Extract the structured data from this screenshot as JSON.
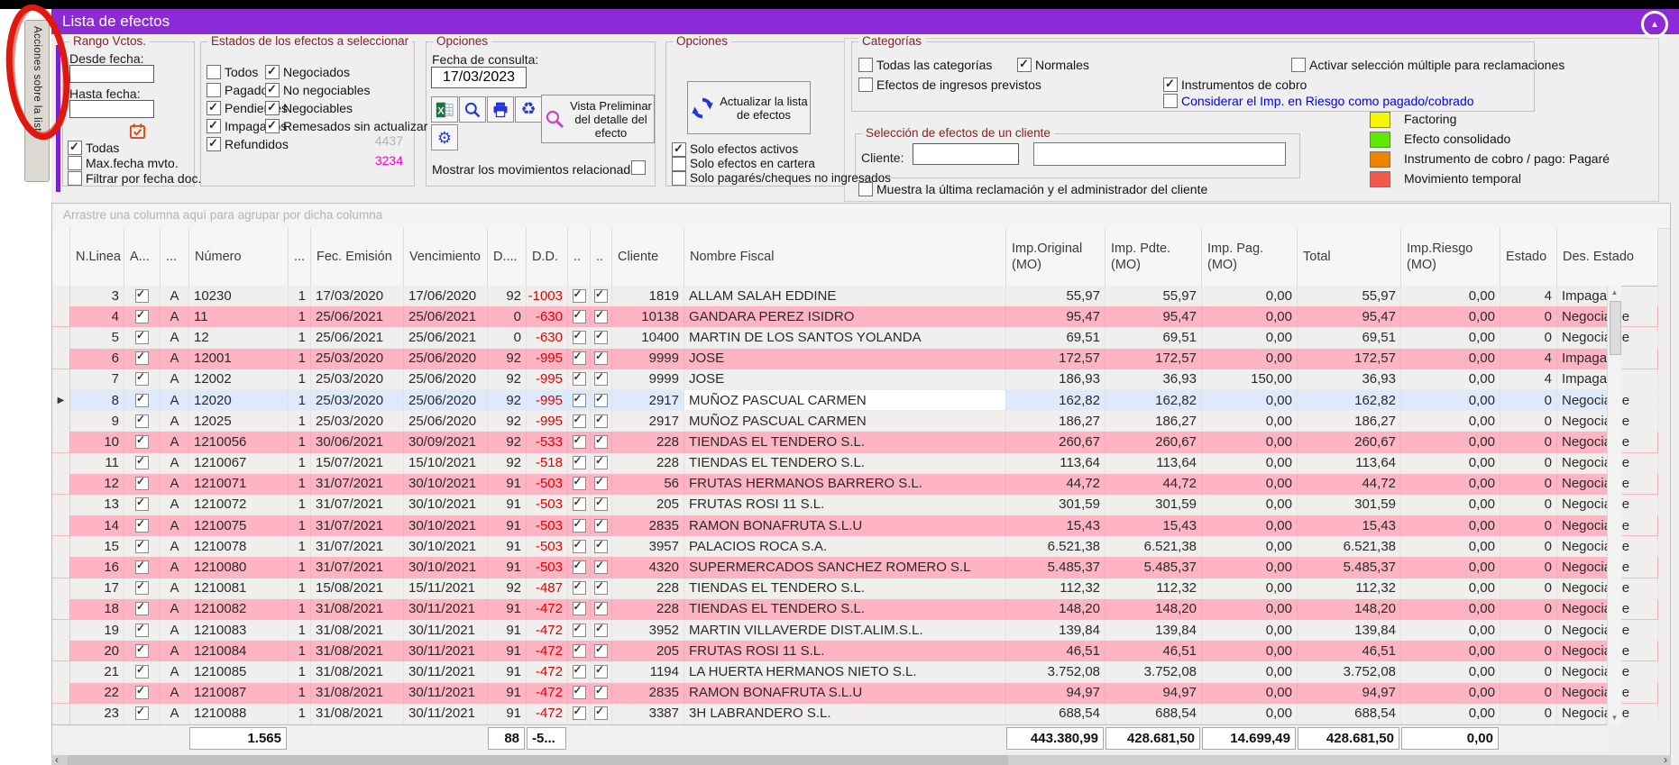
{
  "window": {
    "title": "Lista de efectos"
  },
  "side_tab": {
    "label": "Acciones sobre la lista"
  },
  "icons": {
    "collapse": "▲",
    "scroll_up": "▲",
    "scroll_down": "▼",
    "scroll_left": "‹",
    "scroll_right": "›",
    "row_indicator": "▶"
  },
  "panels": {
    "rango": {
      "title": "Rango Vctos.",
      "desde_label": "Desde fecha:",
      "desde_value": "",
      "hasta_label": "Hasta fecha:",
      "hasta_value": "",
      "todas": {
        "label": "Todas",
        "checked": true
      },
      "max_fecha": {
        "label": "Max.fecha mvto.",
        "checked": false
      },
      "filtrar": {
        "label": "Filtrar por fecha doc.",
        "checked": false
      }
    },
    "estados": {
      "title": "Estados de los efectos a seleccionar",
      "col1": [
        {
          "label": "Todos",
          "checked": false
        },
        {
          "label": "Pagados",
          "checked": false
        },
        {
          "label": "Pendientes",
          "checked": true
        },
        {
          "label": "Impagados",
          "checked": true
        },
        {
          "label": "Refundidos",
          "checked": true
        }
      ],
      "col2": [
        {
          "label": "Negociados",
          "checked": true
        },
        {
          "label": "No negociables",
          "checked": true
        },
        {
          "label": "Negociables",
          "checked": true
        },
        {
          "label": "Remesados sin actualizar",
          "checked": true
        }
      ],
      "count_gray": "4437",
      "count_magenta": "3234"
    },
    "opciones1": {
      "title": "Opciones",
      "fecha_label": "Fecha de consulta:",
      "fecha_value": "17/03/2023",
      "preview_button": "Vista Preliminar del detalle del efecto",
      "mostrar": {
        "label": "Mostrar los movimientos relacionados",
        "checked": false
      }
    },
    "opciones2": {
      "title": "Opciones",
      "actualizar_button": "Actualizar la lista de efectos",
      "checks": [
        {
          "label": "Solo efectos activos",
          "checked": true
        },
        {
          "label": "Solo efectos en cartera",
          "checked": false
        },
        {
          "label": "Solo pagarés/cheques no ingresados",
          "checked": false
        }
      ]
    },
    "categorias": {
      "title": "Categorías",
      "todas_categorias": {
        "label": "Todas las categorías",
        "checked": false
      },
      "normales": {
        "label": "Normales",
        "checked": true
      },
      "efectos_ingresos": {
        "label": "Efectos de ingresos previstos",
        "checked": false
      },
      "instrumentos_cobro": {
        "label": "Instrumentos de cobro",
        "checked": true
      },
      "activar_seleccion": {
        "label": "Activar selección múltiple para reclamaciones",
        "checked": false
      },
      "considerar_riesgo": {
        "label": "Considerar el Imp. en Riesgo como pagado/cobrado",
        "checked": false
      }
    },
    "seleccion": {
      "title": "Selección de efectos de un cliente",
      "cliente_label": "Cliente:",
      "cliente_code": "",
      "cliente_name": ""
    },
    "muestra": {
      "label": "Muestra la última reclamación y el administrador del cliente",
      "checked": false
    }
  },
  "legend": [
    {
      "label": "Factoring",
      "color": "#f6f600"
    },
    {
      "label": "Efecto consolidado",
      "color": "#5fe800"
    },
    {
      "label": "Instrumento de cobro / pago: Pagaré",
      "color": "#ef8200"
    },
    {
      "label": "Movimiento temporal",
      "color": "#f2594a"
    }
  ],
  "grid": {
    "group_hint": "Arrastre una columna aquí para agrupar por dicha columna",
    "columns": [
      "N.Linea",
      "A...",
      "...",
      "Número",
      "...",
      "Fec. Emisión",
      "Vencimiento",
      "D....",
      "D.D.",
      "..",
      "..",
      "Cliente",
      "Nombre Fiscal",
      "Imp.Original (MO)",
      "Imp. Pdte. (MO)",
      "Imp. Pag. (MO)",
      "Total",
      "Imp.Riesgo (MO)",
      "Estado",
      "Des. Estado"
    ],
    "rows": [
      {
        "n": "3",
        "check": true,
        "letter": "A",
        "numero": "10230",
        "uno": "1",
        "emi": "17/03/2020",
        "ven": "17/06/2020",
        "d": "92",
        "dd": "-1003",
        "c1": true,
        "c2": true,
        "cliente": "1819",
        "nombre": "ALLAM SALAH EDDINE",
        "orig": "55,97",
        "pdte": "55,97",
        "pag": "0,00",
        "total": "55,97",
        "riesgo": "0,00",
        "estado": "4",
        "des": "Impagado",
        "bg": "white"
      },
      {
        "n": "4",
        "check": true,
        "letter": "A",
        "numero": "11",
        "uno": "1",
        "emi": "25/06/2021",
        "ven": "25/06/2021",
        "d": "0",
        "dd": "-630",
        "c1": true,
        "c2": true,
        "cliente": "10138",
        "nombre": "GANDARA PEREZ ISIDRO",
        "orig": "95,47",
        "pdte": "95,47",
        "pag": "0,00",
        "total": "95,47",
        "riesgo": "0,00",
        "estado": "0",
        "des": "Negociable",
        "bg": "pink"
      },
      {
        "n": "5",
        "check": true,
        "letter": "A",
        "numero": "12",
        "uno": "1",
        "emi": "25/06/2021",
        "ven": "25/06/2021",
        "d": "0",
        "dd": "-630",
        "c1": true,
        "c2": true,
        "cliente": "10400",
        "nombre": "MARTIN DE LOS SANTOS YOLANDA",
        "orig": "69,51",
        "pdte": "69,51",
        "pag": "0,00",
        "total": "69,51",
        "riesgo": "0,00",
        "estado": "0",
        "des": "Negociable",
        "bg": "white"
      },
      {
        "n": "6",
        "check": true,
        "letter": "A",
        "numero": "12001",
        "uno": "1",
        "emi": "25/03/2020",
        "ven": "25/06/2020",
        "d": "92",
        "dd": "-995",
        "c1": true,
        "c2": true,
        "cliente": "9999",
        "nombre": "JOSE",
        "orig": "172,57",
        "pdte": "172,57",
        "pag": "0,00",
        "total": "172,57",
        "riesgo": "0,00",
        "estado": "4",
        "des": "Impagado",
        "bg": "pink"
      },
      {
        "n": "7",
        "check": true,
        "letter": "A",
        "numero": "12002",
        "uno": "1",
        "emi": "25/03/2020",
        "ven": "25/06/2020",
        "d": "92",
        "dd": "-995",
        "c1": true,
        "c2": true,
        "cliente": "9999",
        "nombre": "JOSE",
        "orig": "186,93",
        "pdte": "36,93",
        "pag": "150,00",
        "total": "36,93",
        "riesgo": "0,00",
        "estado": "4",
        "des": "Impagado",
        "bg": "white"
      },
      {
        "n": "8",
        "check": true,
        "letter": "A",
        "numero": "12020",
        "uno": "1",
        "emi": "25/03/2020",
        "ven": "25/06/2020",
        "d": "92",
        "dd": "-995",
        "c1": true,
        "c2": true,
        "cliente": "2917",
        "nombre": "MUÑOZ PASCUAL CARMEN",
        "orig": "162,82",
        "pdte": "162,82",
        "pag": "0,00",
        "total": "162,82",
        "riesgo": "0,00",
        "estado": "0",
        "des": "Negociable",
        "bg": "selected"
      },
      {
        "n": "9",
        "check": true,
        "letter": "A",
        "numero": "12025",
        "uno": "1",
        "emi": "25/03/2020",
        "ven": "25/06/2020",
        "d": "92",
        "dd": "-995",
        "c1": true,
        "c2": true,
        "cliente": "2917",
        "nombre": "MUÑOZ PASCUAL CARMEN",
        "orig": "186,27",
        "pdte": "186,27",
        "pag": "0,00",
        "total": "186,27",
        "riesgo": "0,00",
        "estado": "0",
        "des": "Negociable",
        "bg": "white"
      },
      {
        "n": "10",
        "check": true,
        "letter": "A",
        "numero": "1210056",
        "uno": "1",
        "emi": "30/06/2021",
        "ven": "30/09/2021",
        "d": "92",
        "dd": "-533",
        "c1": true,
        "c2": true,
        "cliente": "228",
        "nombre": "TIENDAS EL TENDERO S.L.",
        "orig": "260,67",
        "pdte": "260,67",
        "pag": "0,00",
        "total": "260,67",
        "riesgo": "0,00",
        "estado": "0",
        "des": "Negociable",
        "bg": "pink"
      },
      {
        "n": "11",
        "check": true,
        "letter": "A",
        "numero": "1210067",
        "uno": "1",
        "emi": "15/07/2021",
        "ven": "15/10/2021",
        "d": "92",
        "dd": "-518",
        "c1": true,
        "c2": true,
        "cliente": "228",
        "nombre": "TIENDAS EL TENDERO S.L.",
        "orig": "113,64",
        "pdte": "113,64",
        "pag": "0,00",
        "total": "113,64",
        "riesgo": "0,00",
        "estado": "0",
        "des": "Negociable",
        "bg": "white"
      },
      {
        "n": "12",
        "check": true,
        "letter": "A",
        "numero": "1210071",
        "uno": "1",
        "emi": "31/07/2021",
        "ven": "30/10/2021",
        "d": "91",
        "dd": "-503",
        "c1": true,
        "c2": true,
        "cliente": "56",
        "nombre": "FRUTAS HERMANOS BARRERO S.L.",
        "orig": "44,72",
        "pdte": "44,72",
        "pag": "0,00",
        "total": "44,72",
        "riesgo": "0,00",
        "estado": "0",
        "des": "Negociable",
        "bg": "pink"
      },
      {
        "n": "13",
        "check": true,
        "letter": "A",
        "numero": "1210072",
        "uno": "1",
        "emi": "31/07/2021",
        "ven": "30/10/2021",
        "d": "91",
        "dd": "-503",
        "c1": true,
        "c2": true,
        "cliente": "205",
        "nombre": "FRUTAS ROSI 11 S.L.",
        "orig": "301,59",
        "pdte": "301,59",
        "pag": "0,00",
        "total": "301,59",
        "riesgo": "0,00",
        "estado": "0",
        "des": "Negociable",
        "bg": "white"
      },
      {
        "n": "14",
        "check": true,
        "letter": "A",
        "numero": "1210075",
        "uno": "1",
        "emi": "31/07/2021",
        "ven": "30/10/2021",
        "d": "91",
        "dd": "-503",
        "c1": true,
        "c2": true,
        "cliente": "2835",
        "nombre": "RAMON BONAFRUTA S.L.U",
        "orig": "15,43",
        "pdte": "15,43",
        "pag": "0,00",
        "total": "15,43",
        "riesgo": "0,00",
        "estado": "0",
        "des": "Negociable",
        "bg": "pink"
      },
      {
        "n": "15",
        "check": true,
        "letter": "A",
        "numero": "1210078",
        "uno": "1",
        "emi": "31/07/2021",
        "ven": "30/10/2021",
        "d": "91",
        "dd": "-503",
        "c1": true,
        "c2": true,
        "cliente": "3957",
        "nombre": "PALACIOS ROCA S.A.",
        "orig": "6.521,38",
        "pdte": "6.521,38",
        "pag": "0,00",
        "total": "6.521,38",
        "riesgo": "0,00",
        "estado": "0",
        "des": "Negociable",
        "bg": "white"
      },
      {
        "n": "16",
        "check": true,
        "letter": "A",
        "numero": "1210080",
        "uno": "1",
        "emi": "31/07/2021",
        "ven": "30/10/2021",
        "d": "91",
        "dd": "-503",
        "c1": true,
        "c2": true,
        "cliente": "4320",
        "nombre": "SUPERMERCADOS SANCHEZ ROMERO S.L",
        "orig": "5.485,37",
        "pdte": "5.485,37",
        "pag": "0,00",
        "total": "5.485,37",
        "riesgo": "0,00",
        "estado": "0",
        "des": "Negociable",
        "bg": "pink"
      },
      {
        "n": "17",
        "check": true,
        "letter": "A",
        "numero": "1210081",
        "uno": "1",
        "emi": "15/08/2021",
        "ven": "15/11/2021",
        "d": "92",
        "dd": "-487",
        "c1": true,
        "c2": true,
        "cliente": "228",
        "nombre": "TIENDAS EL TENDERO S.L.",
        "orig": "112,32",
        "pdte": "112,32",
        "pag": "0,00",
        "total": "112,32",
        "riesgo": "0,00",
        "estado": "0",
        "des": "Negociable",
        "bg": "white"
      },
      {
        "n": "18",
        "check": true,
        "letter": "A",
        "numero": "1210082",
        "uno": "1",
        "emi": "31/08/2021",
        "ven": "30/11/2021",
        "d": "91",
        "dd": "-472",
        "c1": true,
        "c2": true,
        "cliente": "228",
        "nombre": "TIENDAS EL TENDERO S.L.",
        "orig": "148,20",
        "pdte": "148,20",
        "pag": "0,00",
        "total": "148,20",
        "riesgo": "0,00",
        "estado": "0",
        "des": "Negociable",
        "bg": "pink"
      },
      {
        "n": "19",
        "check": true,
        "letter": "A",
        "numero": "1210083",
        "uno": "1",
        "emi": "31/08/2021",
        "ven": "30/11/2021",
        "d": "91",
        "dd": "-472",
        "c1": true,
        "c2": true,
        "cliente": "3952",
        "nombre": "MARTIN VILLAVERDE DIST.ALIM.S.L.",
        "orig": "139,84",
        "pdte": "139,84",
        "pag": "0,00",
        "total": "139,84",
        "riesgo": "0,00",
        "estado": "0",
        "des": "Negociable",
        "bg": "white"
      },
      {
        "n": "20",
        "check": true,
        "letter": "A",
        "numero": "1210084",
        "uno": "1",
        "emi": "31/08/2021",
        "ven": "30/11/2021",
        "d": "91",
        "dd": "-472",
        "c1": true,
        "c2": true,
        "cliente": "205",
        "nombre": "FRUTAS ROSI 11 S.L.",
        "orig": "46,51",
        "pdte": "46,51",
        "pag": "0,00",
        "total": "46,51",
        "riesgo": "0,00",
        "estado": "0",
        "des": "Negociable",
        "bg": "pink"
      },
      {
        "n": "21",
        "check": true,
        "letter": "A",
        "numero": "1210085",
        "uno": "1",
        "emi": "31/08/2021",
        "ven": "30/11/2021",
        "d": "91",
        "dd": "-472",
        "c1": true,
        "c2": true,
        "cliente": "1194",
        "nombre": "LA HUERTA HERMANOS NIETO S.L.",
        "orig": "3.752,08",
        "pdte": "3.752,08",
        "pag": "0,00",
        "total": "3.752,08",
        "riesgo": "0,00",
        "estado": "0",
        "des": "Negociable",
        "bg": "white"
      },
      {
        "n": "22",
        "check": true,
        "letter": "A",
        "numero": "1210087",
        "uno": "1",
        "emi": "31/08/2021",
        "ven": "30/11/2021",
        "d": "91",
        "dd": "-472",
        "c1": true,
        "c2": true,
        "cliente": "2835",
        "nombre": "RAMON BONAFRUTA S.L.U",
        "orig": "94,97",
        "pdte": "94,97",
        "pag": "0,00",
        "total": "94,97",
        "riesgo": "0,00",
        "estado": "0",
        "des": "Negociable",
        "bg": "pink"
      },
      {
        "n": "23",
        "check": true,
        "letter": "A",
        "numero": "1210088",
        "uno": "1",
        "emi": "31/08/2021",
        "ven": "30/11/2021",
        "d": "91",
        "dd": "-472",
        "c1": true,
        "c2": true,
        "cliente": "3387",
        "nombre": "3H LABRANDERO S.L.",
        "orig": "688,54",
        "pdte": "688,54",
        "pag": "0,00",
        "total": "688,54",
        "riesgo": "0,00",
        "estado": "0",
        "des": "Negociable",
        "bg": "white"
      }
    ],
    "selected_row": "8",
    "footer": {
      "numero": "1.565",
      "d": "88",
      "dd": "-5...",
      "orig": "443.380,99",
      "pdte": "428.681,50",
      "pag": "14.699,49",
      "total": "428.681,50",
      "riesgo": "0,00"
    }
  },
  "colors": {
    "titlebar": "#8c2ad8",
    "pink_row": "#ffb4c4",
    "selected_row": "#dceafb",
    "caption_maroon": "#8b2020",
    "negative_red": "#e00000",
    "count_magenta": "#ff00c8",
    "link_blue": "#0000ee"
  }
}
